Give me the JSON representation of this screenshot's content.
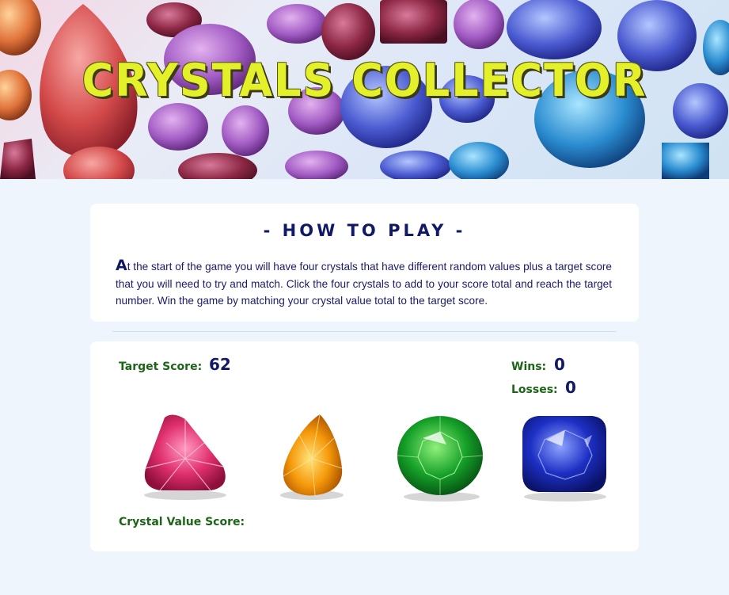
{
  "header": {
    "title": "CRYSTALS COLLECTOR"
  },
  "how_to_play": {
    "title": "- HOW TO PLAY -",
    "drop_cap": "A",
    "text": "t the start of the game you will have four crystals that have different random values plus a target score that you will need to try and match. Click the four crystals to add to your score total and reach the target number. Win the game by matching your crystal value total to the target score."
  },
  "game": {
    "target_label": "Target Score:",
    "target_value": "62",
    "wins_label": "Wins:",
    "wins_value": "0",
    "losses_label": "Losses:",
    "losses_value": "0",
    "crystal_value_label": "Crystal Value Score:",
    "crystal_value": "",
    "crystals": [
      {
        "name": "pink trillion crystal",
        "color": "#e0306e",
        "icon": "trillion-gem"
      },
      {
        "name": "orange pear crystal",
        "color": "#f59a0a",
        "icon": "pear-gem"
      },
      {
        "name": "green round crystal",
        "color": "#15a028",
        "icon": "round-gem"
      },
      {
        "name": "blue cushion crystal",
        "color": "#1d2fc4",
        "icon": "cushion-gem"
      }
    ]
  },
  "colors": {
    "background": "#eef5fd",
    "title_yellow": "#e4f12a",
    "navy": "#111966",
    "label_green": "#1c6416"
  }
}
